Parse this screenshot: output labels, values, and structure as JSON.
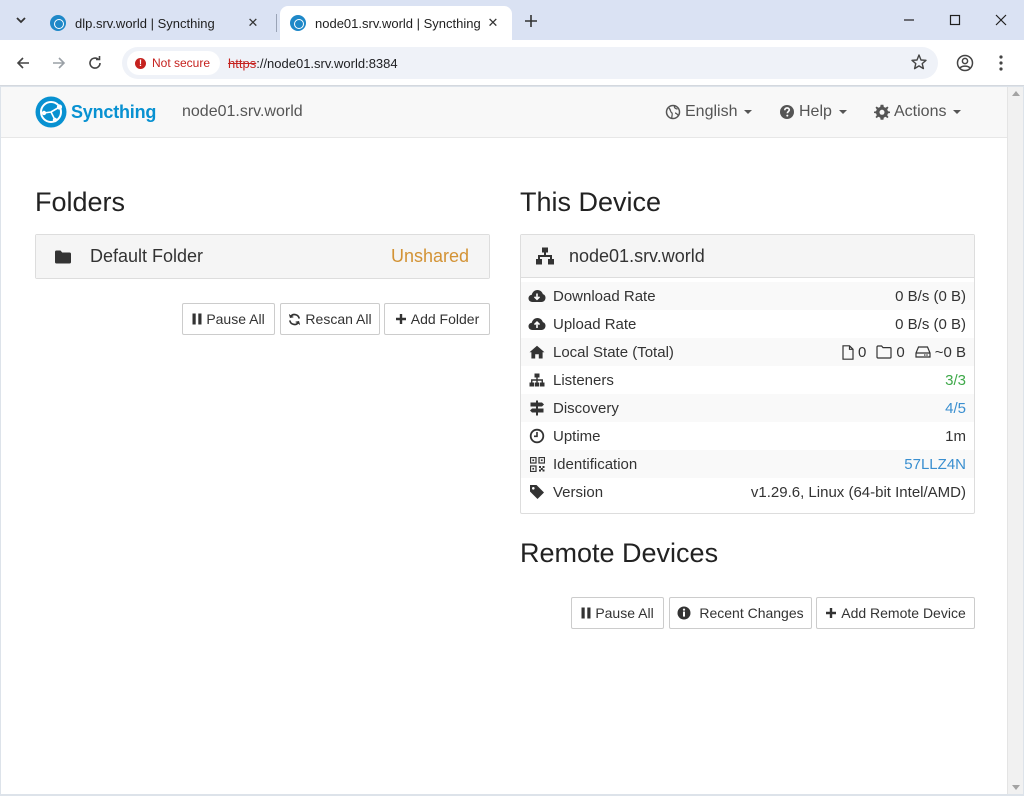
{
  "browser": {
    "tabs": [
      {
        "title": "dlp.srv.world | Syncthing",
        "active": false
      },
      {
        "title": "node01.srv.world | Syncthing",
        "active": true
      }
    ],
    "security_label": "Not secure",
    "url_scheme": "https",
    "url_rest": "://node01.srv.world:8384"
  },
  "navbar": {
    "brand": "Syncthing",
    "hostname": "node01.srv.world",
    "language": "English",
    "help": "Help",
    "actions": "Actions"
  },
  "folders": {
    "title": "Folders",
    "items": [
      {
        "name": "Default Folder",
        "status": "Unshared",
        "status_color": "#d39335"
      }
    ],
    "buttons": {
      "pause_all": "Pause All",
      "rescan_all": "Rescan All",
      "add_folder": "Add Folder"
    }
  },
  "this_device": {
    "title": "This Device",
    "name": "node01.srv.world",
    "rows": {
      "download": {
        "label": "Download Rate",
        "value": "0 B/s (0 B)"
      },
      "upload": {
        "label": "Upload Rate",
        "value": "0 B/s (0 B)"
      },
      "local_state": {
        "label": "Local State (Total)",
        "files": "0",
        "dirs": "0",
        "size": "~0 B"
      },
      "listeners": {
        "label": "Listeners",
        "value": "3/3"
      },
      "discovery": {
        "label": "Discovery",
        "value": "4/5"
      },
      "uptime": {
        "label": "Uptime",
        "value": "1m"
      },
      "identification": {
        "label": "Identification",
        "value": "57LLZ4N"
      },
      "version": {
        "label": "Version",
        "value": "v1.29.6, Linux (64-bit Intel/AMD)"
      }
    }
  },
  "remote_devices": {
    "title": "Remote Devices",
    "buttons": {
      "pause_all": "Pause All",
      "recent_changes": "Recent Changes",
      "add_remote_device": "Add Remote Device"
    }
  },
  "colors": {
    "brand": "#0891d1",
    "unshared": "#d39335",
    "ok_green": "#3fa94a",
    "link_blue": "#3a8fd0"
  }
}
